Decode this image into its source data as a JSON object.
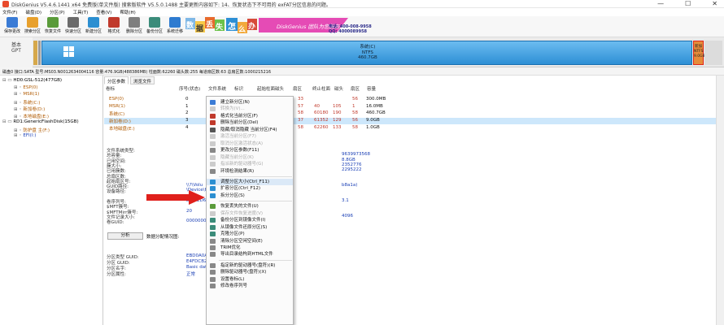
{
  "title": "DiskGenius V5.4.6.1441 x64 免费版(单文件版)  搜索版软件 V5.5.0.1488  主要更新内容如下: 14、恢复状态下不可用的 exFAT分区信息的问题。",
  "window_buttons": [
    "—",
    "☐",
    "✕"
  ],
  "menu": [
    "文件(F)",
    "磁盘(D)",
    "分区(P)",
    "工具(T)",
    "查看(V)",
    "帮助(H)"
  ],
  "toolbar": [
    {
      "label": "保存更改",
      "color": "#3a7bd5"
    },
    {
      "label": "搜索分区",
      "color": "#e8a02c"
    },
    {
      "label": "恢复文件",
      "color": "#5a9b3a"
    },
    {
      "label": "快速分区",
      "color": "#6b6b6b"
    },
    {
      "label": "新建分区",
      "color": "#2c8fd1"
    },
    {
      "label": "格式化",
      "color": "#c0392b"
    },
    {
      "label": "删除分区",
      "color": "#7f7f7f"
    },
    {
      "label": "备份分区",
      "color": "#3b8c7a"
    },
    {
      "label": "系统迁移",
      "color": "#2e7bd0"
    }
  ],
  "banner": {
    "chars": [
      "数",
      "据",
      "丢",
      "失",
      "怎",
      "么",
      "办"
    ],
    "brand": "DiskGenius 团队为您服务",
    "phone": "电话: 400-008-9958",
    "qq": "QQ: 4000089958"
  },
  "disk_bar": {
    "left_label_1": "基本",
    "left_label_2": "GPT",
    "main_name": "系统(C)",
    "main_fs": "NTFS",
    "main_size": "460.7GB",
    "side_labels": [
      "新加",
      "NTFS",
      "9.0GB"
    ]
  },
  "disk_info": "磁盘0 接口:SATA 型号:MS03.N0012634004116 容量:476.9GB(488386MB) 柱面数:62260 磁头数:255 每道扇区数:63 总扇区数:1000215216",
  "tree": [
    {
      "label": "HD0:GSL-512(477GB)",
      "indent": 0,
      "color": "#000"
    },
    {
      "label": "ESP(0)",
      "indent": 1,
      "color": "#b05a00"
    },
    {
      "label": "MSR(1)",
      "indent": 1,
      "color": "#b05a00"
    },
    {
      "label": "系统(C:)",
      "indent": 1,
      "color": "#b05a00"
    },
    {
      "label": "新加卷(D:)",
      "indent": 1,
      "color": "#b05a00"
    },
    {
      "label": "本地磁盘(E:)",
      "indent": 1,
      "color": "#b05a00"
    },
    {
      "label": "RD1:GenericFlashDisk(15GB)",
      "indent": 0,
      "color": "#000"
    },
    {
      "label": "防护盘 主(F:)",
      "indent": 1,
      "color": "#b05a00"
    },
    {
      "label": "EFI(I:)",
      "indent": 1,
      "color": "#1a3fb5"
    }
  ],
  "tabs": [
    "分区参数",
    "浏览文件"
  ],
  "table_headers": [
    "卷标",
    "序号(状态)",
    "文件系统",
    "标识",
    "起始柱面",
    "磁头",
    "扇区",
    "终止柱面",
    "磁头",
    "扇区",
    "容量"
  ],
  "partitions": [
    {
      "name": "ESP(0)",
      "idx": "0",
      "c1": "33",
      "c2": "",
      "c3": "",
      "c4": "",
      "c5": "56",
      "size": "300.0MB"
    },
    {
      "name": "MSR(1)",
      "idx": "1",
      "c1": "57",
      "c2": "",
      "c3": "40",
      "c4": "105",
      "c5": "1",
      "size": "16.0MB"
    },
    {
      "name": "系统(C)",
      "idx": "2",
      "c1": "58",
      "c2": "",
      "c3": "60180",
      "c4": "190",
      "c5": "58",
      "size": "460.7GB"
    },
    {
      "name": "新加卷(D:)",
      "idx": "3",
      "c1": "37",
      "c2": "",
      "c3": "61352",
      "c4": "129",
      "c5": "56",
      "size": "9.0GB"
    },
    {
      "name": "本地磁盘(E:)",
      "idx": "4",
      "c1": "58",
      "c2": "",
      "c3": "62260",
      "c4": "133",
      "c5": "58",
      "size": "1.0GB"
    }
  ],
  "details_left": [
    "文件系统类型:",
    "总容量:",
    "已用空间:",
    "簇大小:",
    "已用簇数:",
    "总扇区数:",
    "起始扇区号:",
    "GUID路径:",
    "设备路径:",
    "",
    "卷序列号:",
    "$MFT簇号:",
    "$MFTMirr簇号:",
    "文件记录大小:",
    "卷GUID:"
  ],
  "details_mid": [
    "",
    "",
    "",
    "",
    "",
    "",
    "",
    "\\\\?\\Volu",
    "\\Device\\Ha",
    "",
    "D44 ED6A",
    "",
    "20",
    "",
    "00000000"
  ],
  "details_right": [
    "",
    "9639973568",
    "8.8GB",
    "2352776",
    "2295222",
    "",
    "",
    "b8a1a)",
    "",
    "",
    "3.1",
    "",
    "",
    "4096",
    ""
  ],
  "analyze_button": "分析",
  "analyze_label": "数据分配情况图:",
  "details_bottom_left": [
    "分区类型 GUID:",
    "分区 GUID:",
    "分区名字:",
    "分区属性:"
  ],
  "details_bottom_mid": [
    "EBD0A0A",
    "E4FDCB2",
    "Basic dat",
    "正常"
  ],
  "context_menu": [
    {
      "label": "建立新分区(N)",
      "dis": false,
      "icon": "#3a7bd5"
    },
    {
      "label": "转换为(V)...",
      "dis": true,
      "icon": "#ccc"
    },
    {
      "label": "格式化当前分区(F)",
      "dis": false,
      "icon": "#c0392b"
    },
    {
      "label": "删除当前分区(Del)",
      "dis": false,
      "icon": "#c0392b"
    },
    {
      "label": "隐藏/取消隐藏 当前分区(F4)",
      "dis": false,
      "icon": "#555"
    },
    {
      "label": "激活当前分区(F7)",
      "dis": true,
      "icon": "#ccc"
    },
    {
      "label": "取消分区激活状态(A)",
      "dis": true,
      "icon": "#ccc"
    },
    {
      "label": "更改分区参数(F11)",
      "dis": false,
      "icon": "#888"
    },
    {
      "label": "隐藏当前分区(K)",
      "dis": true,
      "icon": "#ccc"
    },
    {
      "label": "指派新的驱动器号(G)",
      "dis": true,
      "icon": "#ccc"
    },
    {
      "label": "环境检测结果(R)",
      "dis": false,
      "icon": "#888"
    },
    {
      "sep": true
    },
    {
      "label": "调整分区大小(Ctrl_F11)",
      "dis": false,
      "icon": "#2c8fd1",
      "hl": true
    },
    {
      "label": "扩容分区(Ctrl_F12)",
      "dis": false,
      "icon": "#2c8fd1"
    },
    {
      "label": "拆分分区(S)",
      "dis": false,
      "icon": "#2c8fd1"
    },
    {
      "sep": true
    },
    {
      "label": "恢复丢失的文件(U)",
      "dis": false,
      "icon": "#5a9b3a"
    },
    {
      "label": "保存文件恢复进度(V)",
      "dis": true,
      "icon": "#ccc"
    },
    {
      "label": "备份分区到镜像文件(I)",
      "dis": false,
      "icon": "#3b8c7a"
    },
    {
      "label": "从镜像文件还原分区(S)",
      "dis": false,
      "icon": "#3b8c7a"
    },
    {
      "label": "克隆分区(P)",
      "dis": false,
      "icon": "#3b8c7a"
    },
    {
      "label": "清除分区空闲空间(E)",
      "dis": false,
      "icon": "#888"
    },
    {
      "label": "TRIM优化",
      "dis": false,
      "icon": "#888"
    },
    {
      "label": "导出目录结构到HTML文件",
      "dis": false,
      "icon": "#888"
    },
    {
      "sep": true
    },
    {
      "label": "指定新的驱动器号(盘符)(R)",
      "dis": false,
      "icon": "#888"
    },
    {
      "label": "删除驱动器号(盘符)(X)",
      "dis": false,
      "icon": "#888"
    },
    {
      "label": "设置卷标(L)",
      "dis": false,
      "icon": "#888"
    },
    {
      "label": "修改卷序列号",
      "dis": false,
      "icon": "#888"
    }
  ]
}
